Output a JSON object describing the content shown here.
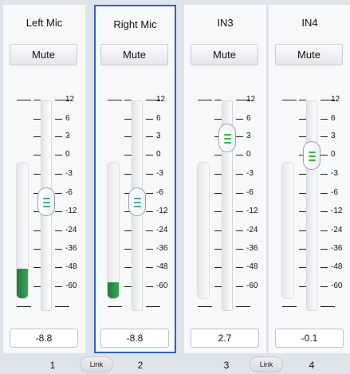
{
  "mixer": {
    "channels": [
      {
        "name": "Left Mic",
        "mute_label": "Mute",
        "value": "-8.8",
        "number": "1",
        "gain_db": -8.8,
        "meter_level": 0.22,
        "selected": false
      },
      {
        "name": "Right Mic",
        "mute_label": "Mute",
        "value": "-8.8",
        "number": "2",
        "gain_db": -8.8,
        "meter_level": 0.12,
        "selected": true
      },
      {
        "name": "IN3",
        "mute_label": "Mute",
        "value": "2.7",
        "number": "3",
        "gain_db": 2.7,
        "meter_level": 0,
        "selected": false
      },
      {
        "name": "IN4",
        "mute_label": "Mute",
        "value": "-0.1",
        "number": "4",
        "gain_db": -0.1,
        "meter_level": 0,
        "selected": false
      }
    ],
    "scale_labels": [
      "12",
      "6",
      "3",
      "0",
      "-3",
      "-6",
      "-12",
      "-24",
      "-36",
      "-48",
      "-60"
    ],
    "link_label": "Link",
    "colors": {
      "meter_green": "#2e8b4a",
      "knob_left": "#4fa3a0",
      "knob_right": "#39b54a",
      "selected_border": "#2f5fd0"
    }
  }
}
